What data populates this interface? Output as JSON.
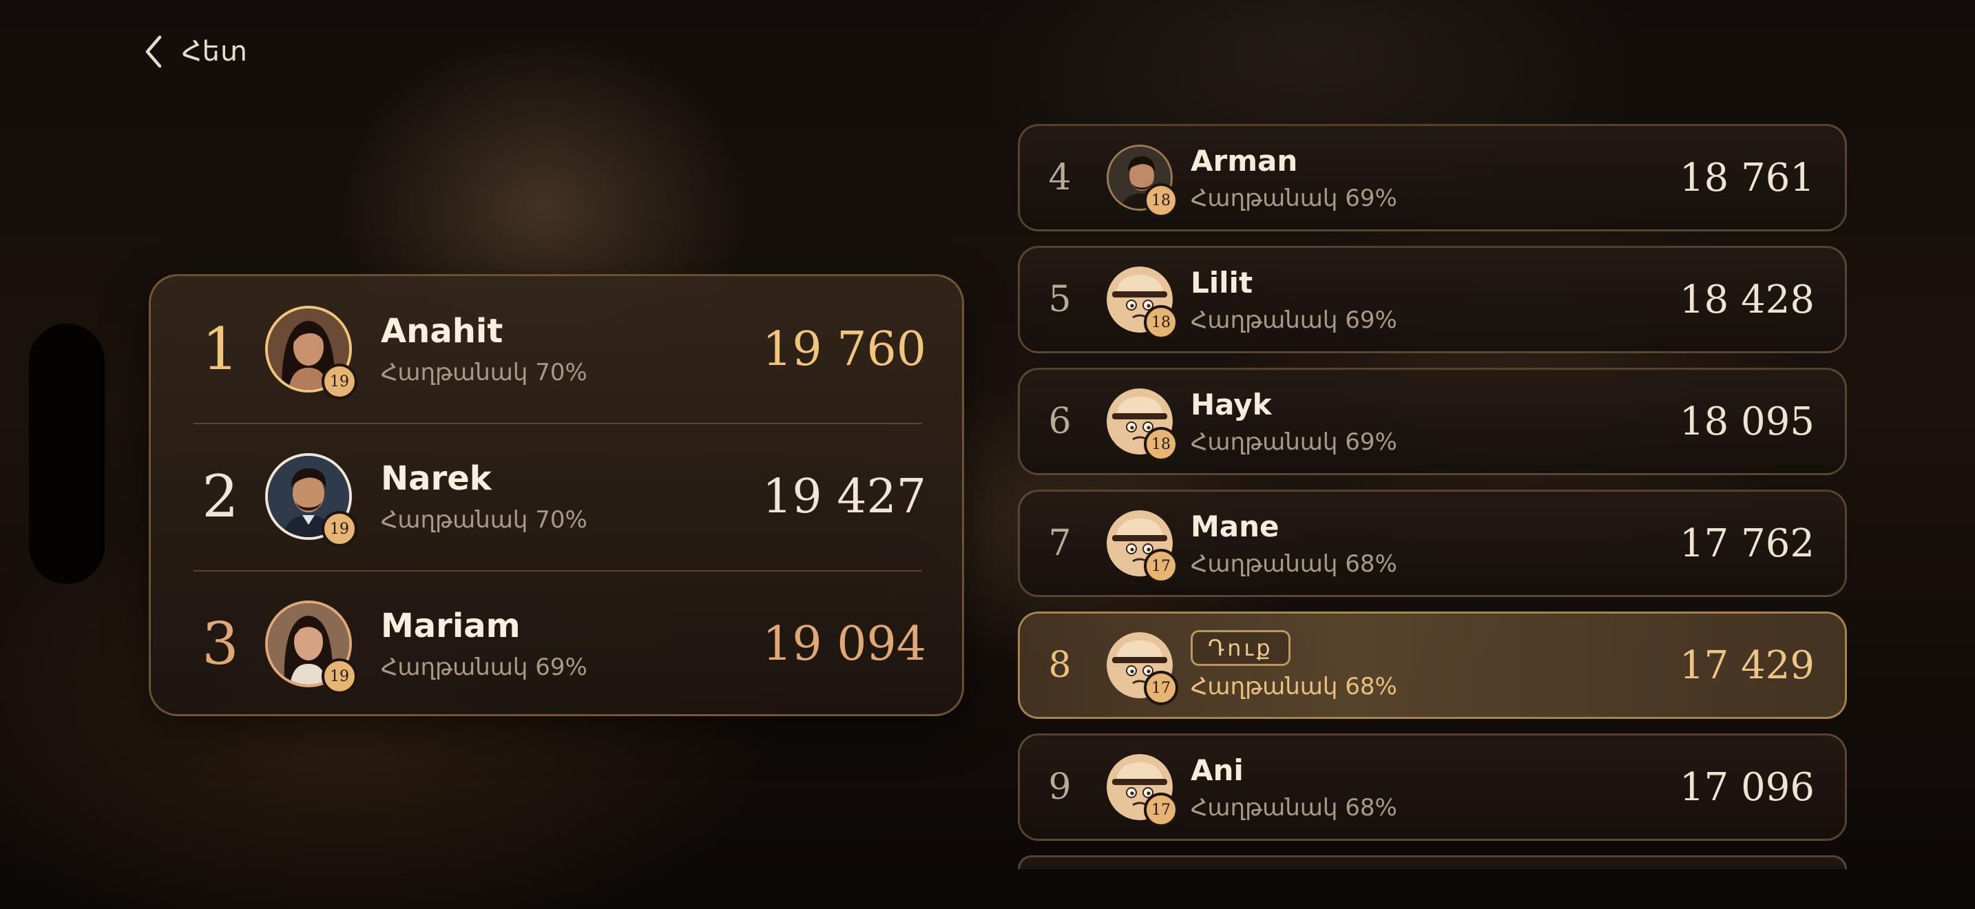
{
  "back": {
    "label": "Հետ"
  },
  "colors": {
    "gold": "#F1C57C",
    "silver": "#EFE6D8",
    "bronze": "#E0A877",
    "accent": "#E6B573"
  },
  "podium": [
    {
      "rank": "1",
      "name": "Anahit",
      "sub": "Հաղթանակ 70%",
      "score": "19 760",
      "level": "19",
      "medal": "gold",
      "avatar": "woman-portrait-icon"
    },
    {
      "rank": "2",
      "name": "Narek",
      "sub": "Հաղթանակ 70%",
      "score": "19 427",
      "level": "19",
      "medal": "silver",
      "avatar": "man-portrait-icon"
    },
    {
      "rank": "3",
      "name": "Mariam",
      "sub": "Հաղթանակ 69%",
      "score": "19 094",
      "level": "19",
      "medal": "bronze",
      "avatar": "woman-portrait-icon"
    }
  ],
  "list": [
    {
      "rank": "4",
      "name": "Arman",
      "sub": "Հաղթանակ 69%",
      "score": "18 761",
      "level": "18",
      "avatar": "man-portrait-icon"
    },
    {
      "rank": "5",
      "name": "Lilit",
      "sub": "Հաղթանակ 69%",
      "score": "18 428",
      "level": "18",
      "avatar": "default-avatar-icon"
    },
    {
      "rank": "6",
      "name": "Hayk",
      "sub": "Հաղթանակ 69%",
      "score": "18 095",
      "level": "18",
      "avatar": "default-avatar-icon"
    },
    {
      "rank": "7",
      "name": "Mane",
      "sub": "Հաղթանակ 68%",
      "score": "17 762",
      "level": "17",
      "avatar": "default-avatar-icon"
    },
    {
      "rank": "8",
      "name": "",
      "you_label": "Դուք",
      "sub": "Հաղթանակ 68%",
      "score": "17 429",
      "level": "17",
      "avatar": "default-avatar-icon",
      "is_current_user": true
    },
    {
      "rank": "9",
      "name": "Ani",
      "sub": "Հաղթանակ 68%",
      "score": "17 096",
      "level": "17",
      "avatar": "default-avatar-icon"
    }
  ]
}
